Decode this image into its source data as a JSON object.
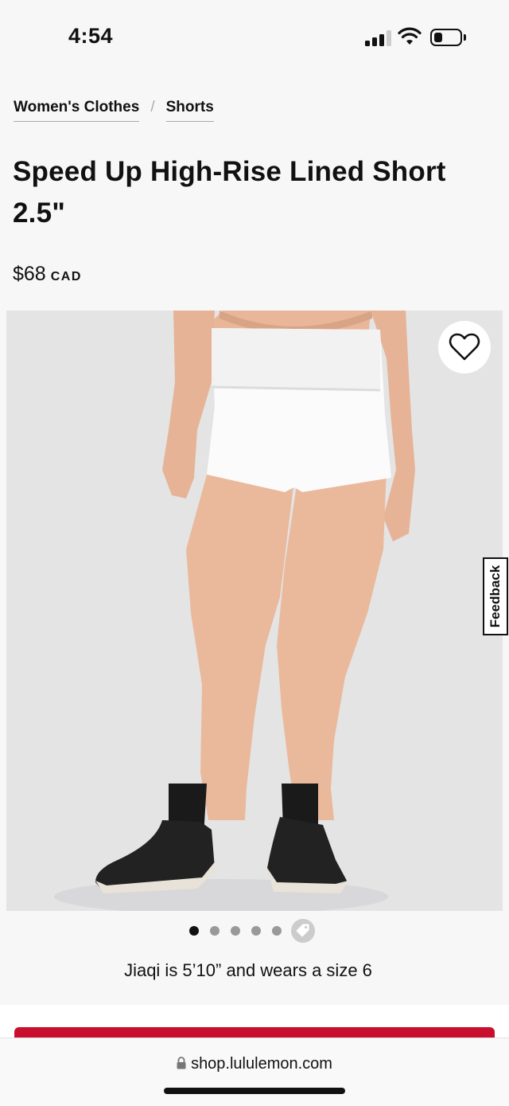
{
  "status_bar": {
    "time": "4:54"
  },
  "breadcrumb": {
    "items": [
      "Women's Clothes",
      "Shorts"
    ],
    "separator": "/"
  },
  "product": {
    "title": "Speed Up High-Rise Lined Short 2.5\"",
    "price": "$68",
    "currency": "CAD",
    "model_info": "Jiaqi is 5’10” and wears a size 6",
    "image_count": 6,
    "active_image": 1
  },
  "feedback": {
    "label": "Feedback"
  },
  "browser": {
    "url": "shop.lululemon.com"
  },
  "colors": {
    "brand_red": "#c8102e",
    "background": "#f7f7f7",
    "image_bg": "#e5e5e6"
  }
}
